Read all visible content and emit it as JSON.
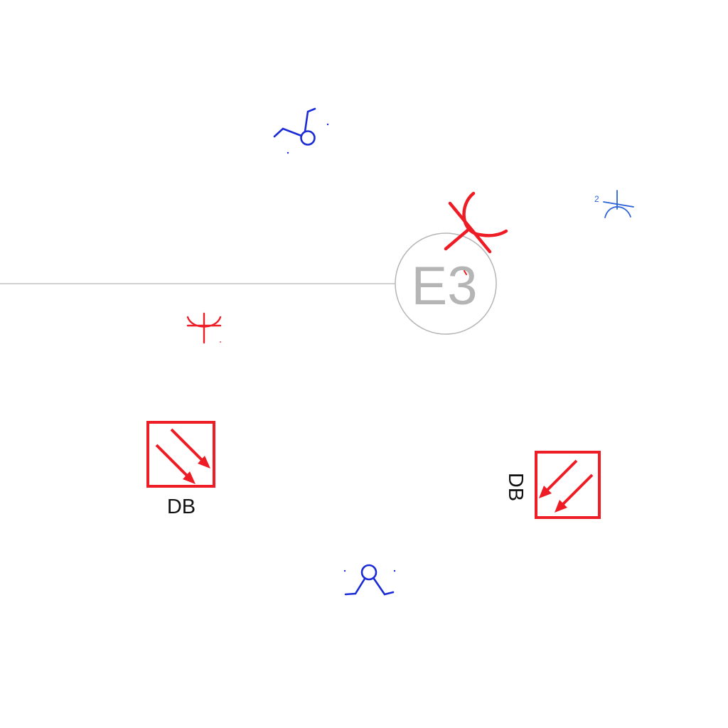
{
  "grid_bubble": {
    "label": "E3"
  },
  "symbols": {
    "sheet_number": "2",
    "distribution_board_1": {
      "label": "DB"
    },
    "distribution_board_2": {
      "label": "DB"
    }
  },
  "colors": {
    "background": "#ffffff",
    "grid_line": "#b5b5b5",
    "red": "#ee1c24",
    "blue": "#1a2bd6",
    "light_blue": "#2c63d8",
    "label_text": "#111111"
  }
}
